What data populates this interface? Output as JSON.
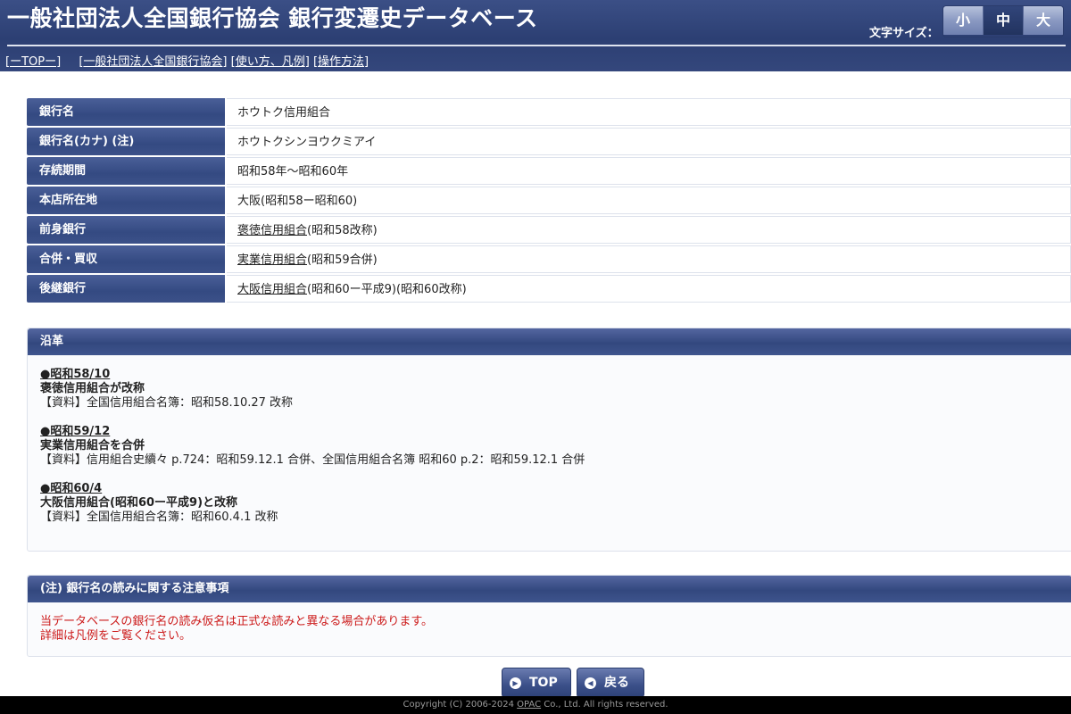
{
  "header": {
    "title": "一般社団法人全国銀行協会 銀行変遷史データベース",
    "font_size_label": "文字サイズ：",
    "font_sizes": [
      "小",
      "中",
      "大"
    ],
    "font_size_selected": "中"
  },
  "nav": {
    "top": "[ーTOPー]",
    "bracket_open": "[",
    "bracket_close": "]",
    "items": [
      "一般社団法人全国銀行協会",
      "使い方、凡例",
      "操作方法"
    ]
  },
  "info": {
    "bank_name": {
      "label": "銀行名",
      "value": "ホウトク信用組合"
    },
    "bank_kana": {
      "label": "銀行名(カナ) (注)",
      "value": "ホウトクシンヨウクミアイ"
    },
    "period": {
      "label": "存続期間",
      "value": "昭和58年～昭和60年"
    },
    "hq": {
      "label": "本店所在地",
      "value": "大阪(昭和58ー昭和60)"
    },
    "predecessor": {
      "label": "前身銀行",
      "link": "褒徳信用組合",
      "suffix": "(昭和58改称)"
    },
    "merger": {
      "label": "合併・買収",
      "link": "実業信用組合",
      "suffix": "(昭和59合併)"
    },
    "successor": {
      "label": "後継銀行",
      "link": "大阪信用組合",
      "suffix": "(昭和60ー平成9)(昭和60改称)"
    }
  },
  "history": {
    "heading": "沿革",
    "entries": [
      {
        "date": "●昭和58/10",
        "title": "褒徳信用組合が改称",
        "source": "【資料】全国信用組合名簿：昭和58.10.27 改称"
      },
      {
        "date": "●昭和59/12",
        "title": "実業信用組合を合併",
        "source": "【資料】信用組合史續々 p.724：昭和59.12.1 合併、全国信用組合名簿 昭和60 p.2：昭和59.12.1 合併"
      },
      {
        "date": "●昭和60/4",
        "title": "大阪信用組合(昭和60ー平成9)と改称",
        "source": "【資料】全国信用組合名簿：昭和60.4.1 改称"
      }
    ]
  },
  "note": {
    "heading": "(注) 銀行名の読みに関する注意事項",
    "line1": "当データベースの銀行名の読み仮名は正式な読みと異なる場合があります。",
    "line2": "詳細は凡例をご覧ください。",
    "color": "#cc1a1a"
  },
  "buttons": {
    "top": "TOP",
    "back": "戻る"
  },
  "footer": {
    "prefix": "Copyright (C) 2006-2024 ",
    "link": "OPAC",
    "suffix": " Co., Ltd. All rights reserved."
  }
}
